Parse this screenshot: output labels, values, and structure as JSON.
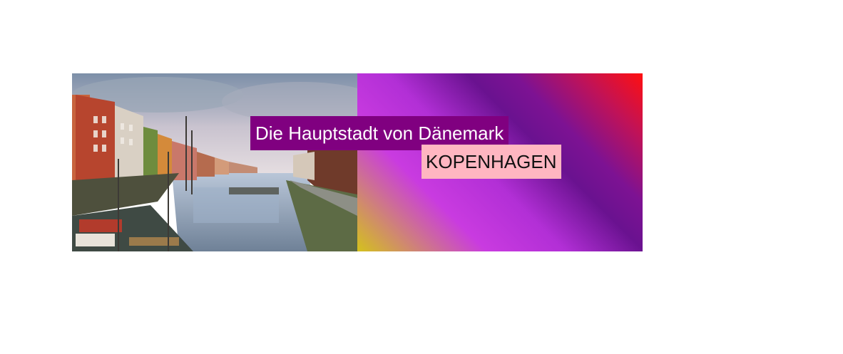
{
  "banner": {
    "subtitle": "Die Hauptstadt von Dänemark",
    "title": "KOPENHAGEN",
    "photo_alt": "Nyhavn canal in Copenhagen",
    "colors": {
      "subtitle_bg": "#800080",
      "subtitle_text": "#ffffff",
      "title_bg": "#ffb6c1",
      "title_text": "#111111",
      "gradient": [
        "#d4c21c",
        "#c93be0",
        "#6a1290",
        "#ff1010"
      ]
    }
  }
}
